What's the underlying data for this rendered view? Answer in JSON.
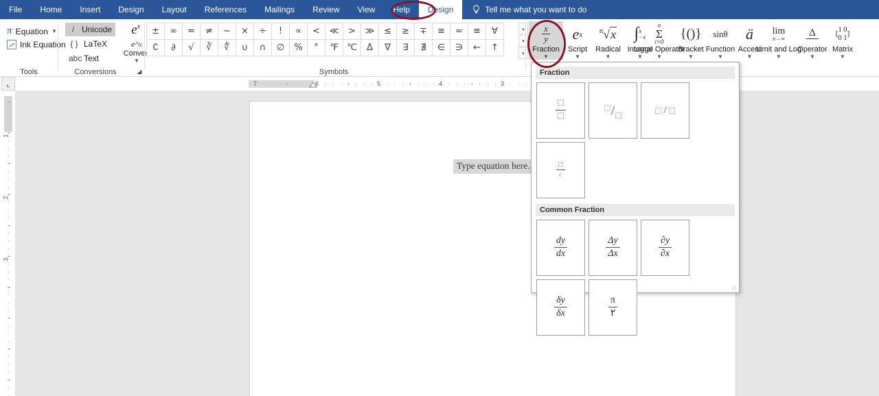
{
  "window": {
    "app": "Word"
  },
  "tabs": {
    "items": [
      {
        "label": "File",
        "active": false
      },
      {
        "label": "Home",
        "active": false
      },
      {
        "label": "Insert",
        "active": false
      },
      {
        "label": "Design",
        "active": false
      },
      {
        "label": "Layout",
        "active": false
      },
      {
        "label": "References",
        "active": false
      },
      {
        "label": "Mailings",
        "active": false
      },
      {
        "label": "Review",
        "active": false
      },
      {
        "label": "View",
        "active": false
      },
      {
        "label": "Help",
        "active": false
      },
      {
        "label": "Design",
        "active": true
      }
    ],
    "tell_me": "Tell me what you want to do",
    "tell_me_icon": "lightbulb-icon"
  },
  "ribbon": {
    "groups": [
      {
        "name": "Tools",
        "label": "Tools"
      },
      {
        "name": "Conversions",
        "label": "Conversions"
      },
      {
        "name": "Symbols",
        "label": "Symbols"
      }
    ],
    "tools": {
      "equation_label": "Equation",
      "equation_icon": "pi-icon",
      "ink_equation_label": "Ink Equation",
      "ink_equation_icon": "ink-pen-icon"
    },
    "conversions": {
      "unicode_label": "Unicode",
      "unicode_glyph": "/",
      "unicode_selected": true,
      "latex_label": "LaTeX",
      "latex_glyph": "{ }",
      "text_label": "Text",
      "text_glyph": "abc",
      "convert_label": "Convert",
      "convert_icon": "e-to-x-convert-icon",
      "dialog_launcher": "⌐"
    },
    "symbols": {
      "row1": [
        "±",
        "∞",
        "=",
        "≠",
        "~",
        "×",
        "÷",
        "!",
        "∝",
        "<",
        "≪",
        ">",
        "≫",
        "≤",
        "≥",
        "∓",
        "≅",
        "≈",
        "≡",
        "∀"
      ],
      "row2": [
        "∁",
        "∂",
        "√",
        "∛",
        "∜",
        "∪",
        "∩",
        "∅",
        "%",
        "°",
        "℉",
        "℃",
        "Δ",
        "∇",
        "∃",
        "∄",
        "∈",
        "∋",
        "←",
        "↑"
      ],
      "scroll_up": "▴",
      "scroll_down": "▾",
      "scroll_more": "▾"
    },
    "structures": [
      {
        "name": "fraction",
        "label": "Fraction",
        "icon": "fraction-icon",
        "selected": true
      },
      {
        "name": "script",
        "label": "Script",
        "icon": "script-exponent-icon",
        "selected": false
      },
      {
        "name": "radical",
        "label": "Radical",
        "icon": "nth-root-icon",
        "selected": false
      },
      {
        "name": "integral",
        "label": "Integral",
        "icon": "integral-icon",
        "selected": false
      },
      {
        "name": "large-operator",
        "label": "Large Operator",
        "icon": "sigma-icon",
        "selected": false
      },
      {
        "name": "bracket",
        "label": "Bracket",
        "icon": "bracket-icon",
        "selected": false
      },
      {
        "name": "function",
        "label": "Function",
        "icon": "sin-theta-icon",
        "selected": false
      },
      {
        "name": "accent",
        "label": "Accent",
        "icon": "a-umlaut-icon",
        "selected": false
      },
      {
        "name": "limit-and-log",
        "label": "Limit and Log",
        "icon": "limit-icon",
        "selected": false
      },
      {
        "name": "operator",
        "label": "Operator",
        "icon": "delta-over-line-icon",
        "selected": false
      },
      {
        "name": "matrix",
        "label": "Matrix",
        "icon": "matrix-icon",
        "selected": false
      }
    ]
  },
  "gallery": {
    "sections": [
      {
        "title": "Fraction",
        "items": [
          {
            "name": "stacked-fraction",
            "kind": "stacked",
            "num": "□",
            "den": "□"
          },
          {
            "name": "skewed-fraction",
            "kind": "skewed",
            "num": "□",
            "den": "□"
          },
          {
            "name": "linear-fraction",
            "kind": "linear",
            "num": "□",
            "den": "□"
          },
          {
            "name": "small-stacked-fraction",
            "kind": "stacked-sm",
            "num": "□",
            "den": "□"
          }
        ]
      },
      {
        "title": "Common Fraction",
        "items": [
          {
            "name": "dy-dx",
            "kind": "stacked",
            "num": "dy",
            "den": "dx"
          },
          {
            "name": "delta-y-delta-x",
            "kind": "stacked",
            "num": "Δy",
            "den": "Δx"
          },
          {
            "name": "partial-y-partial-x",
            "kind": "stacked",
            "num": "∂y",
            "den": "∂x"
          },
          {
            "name": "small-delta-y-small-delta-x",
            "kind": "stacked",
            "num": "δy",
            "den": "δx"
          },
          {
            "name": "pi-over-two",
            "kind": "stacked",
            "num": "π",
            "den": "٢"
          }
        ]
      }
    ],
    "resize_grip": "⁙"
  },
  "document": {
    "equation_placeholder": "Type equation here.",
    "h_ruler_marks": [
      "7",
      "6",
      "5",
      "4",
      "3"
    ],
    "v_ruler_marks": [
      "1",
      "2",
      "3"
    ],
    "ruler_corner_icon": "tab-stop-icon"
  },
  "annotations": [
    {
      "name": "design-tab-highlight-circle",
      "color": "#8c1225"
    },
    {
      "name": "fraction-button-highlight-circle",
      "color": "#8c1225"
    }
  ],
  "colors": {
    "ribbon_blue": "#2b579a",
    "annotation_red": "#8c1225",
    "selection_gray": "#d6d6d6",
    "canvas_gray": "#e6e6e6"
  }
}
